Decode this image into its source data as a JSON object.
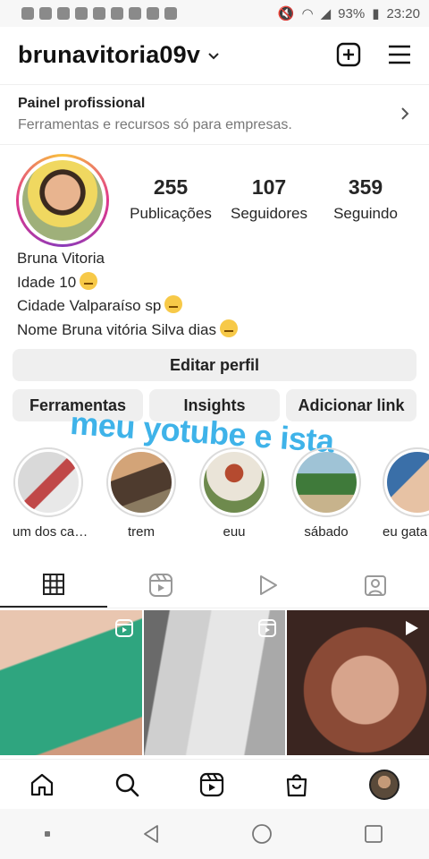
{
  "status_bar": {
    "battery": "93%",
    "time": "23:20"
  },
  "header": {
    "username": "brunavitoria09v"
  },
  "pro_panel": {
    "title": "Painel profissional",
    "subtitle": "Ferramentas e recursos só para empresas."
  },
  "stats": [
    {
      "value": "255",
      "label": "Publicações"
    },
    {
      "value": "107",
      "label": "Seguidores"
    },
    {
      "value": "359",
      "label": "Seguindo"
    }
  ],
  "bio": {
    "name": "Bruna Vitoria",
    "lines": [
      "Idade 10",
      "Cidade Valparaíso sp",
      "Nome Bruna vitória Silva dias"
    ]
  },
  "buttons": {
    "edit_profile": "Editar perfil",
    "tools": "Ferramentas",
    "insights": "Insights",
    "add": "Adicionar link"
  },
  "overlay": "meu yotube e ista",
  "highlights": [
    {
      "label": "um dos  ca…"
    },
    {
      "label": "trem"
    },
    {
      "label": "euu"
    },
    {
      "label": "sábado"
    },
    {
      "label": "eu gata"
    }
  ],
  "icons": {
    "tabs": [
      "grid-icon",
      "reels-icon",
      "video-play-icon",
      "tagged-icon"
    ],
    "bottom_nav": [
      "home-icon",
      "search-icon",
      "reels-icon",
      "shop-icon",
      "profile-avatar"
    ]
  }
}
